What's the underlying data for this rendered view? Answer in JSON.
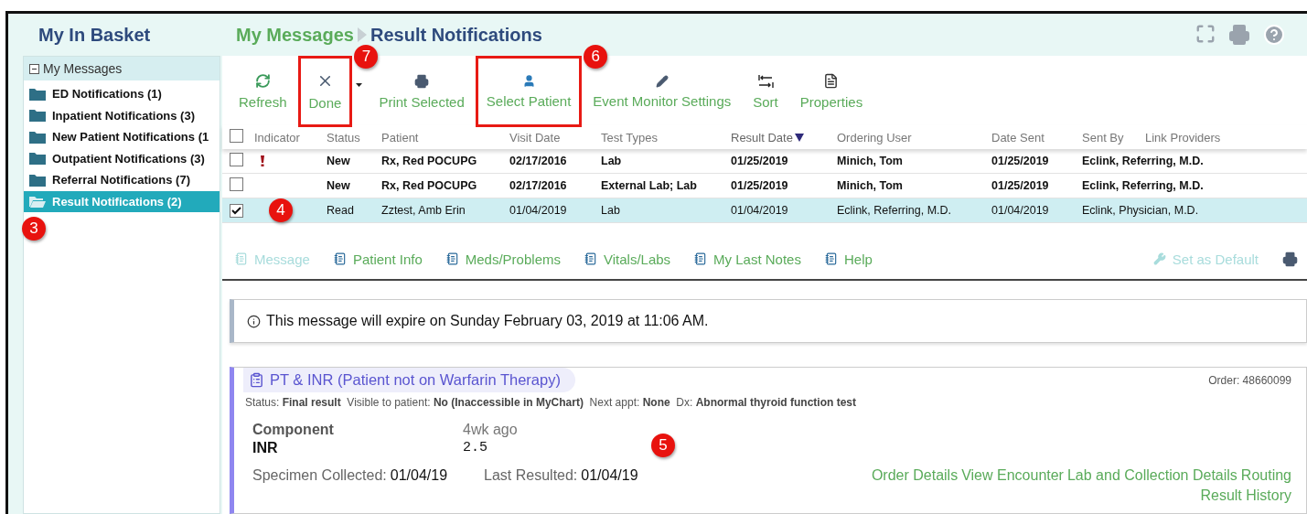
{
  "header": {
    "title": "My In Basket",
    "breadcrumb": [
      {
        "label": "My Messages",
        "current": false
      },
      {
        "label": "Result Notifications",
        "current": true
      }
    ]
  },
  "sidebar": {
    "root": {
      "label": "My Messages",
      "expanded": true
    },
    "folders": [
      {
        "label": "ED Notifications (1)",
        "selected": false
      },
      {
        "label": "Inpatient Notifications (3)",
        "selected": false
      },
      {
        "label": "New Patient Notifications (1",
        "selected": false
      },
      {
        "label": "Outpatient Notifications (3)",
        "selected": false
      },
      {
        "label": "Referral Notifications (7)",
        "selected": false
      },
      {
        "label": "Result Notifications (2)",
        "selected": true,
        "callout": "3"
      }
    ]
  },
  "toolbar": [
    {
      "label": "Refresh",
      "kind": "refresh",
      "highlighted": false
    },
    {
      "label": "Done",
      "kind": "done",
      "highlighted": true,
      "callout": "7",
      "menu": true
    },
    {
      "label": "Print Selected",
      "kind": "print",
      "highlighted": false
    },
    {
      "label": "Select Patient",
      "kind": "patient",
      "highlighted": true,
      "callout": "6"
    },
    {
      "label": "Event Monitor Settings",
      "kind": "settings",
      "highlighted": false
    },
    {
      "label": "Sort",
      "kind": "sort",
      "highlighted": false
    },
    {
      "label": "Properties",
      "kind": "properties",
      "highlighted": false
    }
  ],
  "table": {
    "all_checked": false,
    "columns": [
      {
        "label": "Indicator",
        "sorted": false
      },
      {
        "label": "Status",
        "sorted": false
      },
      {
        "label": "Patient",
        "sorted": false
      },
      {
        "label": "Visit Date",
        "sorted": false
      },
      {
        "label": "Test Types",
        "sorted": false
      },
      {
        "label": "Result Date",
        "sorted": true
      },
      {
        "label": "Ordering User",
        "sorted": false
      },
      {
        "label": "Date Sent",
        "sorted": false
      },
      {
        "label": "Sent By",
        "sorted": false
      },
      {
        "label": "Link Providers",
        "sorted": false
      }
    ],
    "rows": [
      {
        "checked": false,
        "selected": false,
        "unread": true,
        "flagged": true,
        "cells": [
          "",
          "New",
          "Rx, Red POCUPG",
          "02/17/2016",
          "Lab",
          "01/25/2019",
          "Minich, Tom",
          "01/25/2019",
          "Eclink, Referring, M.D."
        ]
      },
      {
        "checked": false,
        "selected": false,
        "unread": true,
        "flagged": false,
        "cells": [
          "",
          "New",
          "Rx, Red POCUPG",
          "02/17/2016",
          "External Lab; Lab",
          "01/25/2019",
          "Minich, Tom",
          "01/25/2019",
          "Eclink, Referring, M.D."
        ]
      },
      {
        "checked": true,
        "selected": true,
        "unread": false,
        "flagged": false,
        "callout": "4",
        "cells": [
          "",
          "Read",
          "Zztest, Amb Erin",
          "01/04/2019",
          "Lab",
          "01/04/2019",
          "Eclink, Referring, M.D.",
          "01/04/2019",
          "Eclink, Physician, M.D."
        ]
      }
    ]
  },
  "nav_links": [
    {
      "label": "Message",
      "disabled": true
    },
    {
      "label": "Patient Info",
      "disabled": false
    },
    {
      "label": "Meds/Problems",
      "disabled": false
    },
    {
      "label": "Vitals/Labs",
      "disabled": false
    },
    {
      "label": "My Last Notes",
      "disabled": false
    },
    {
      "label": "Help",
      "disabled": false
    }
  ],
  "set_default": {
    "label": "Set as Default",
    "disabled": true
  },
  "notice": "This message will expire on Sunday February 03, 2019 at 11:06 AM.",
  "result": {
    "title": "PT & INR (Patient not on Warfarin Therapy)",
    "order": "Order: 48660099",
    "meta": "Status: **Final result**  Visible to patient: **No (Inaccessible in MyChart)**  Next appt: **None**  Dx: **Abnormal thyroid function test**",
    "component_header": "Component",
    "time_header": "4wk ago",
    "component": "INR",
    "value": "2.5",
    "callout": "5",
    "dates": [
      {
        "label": "Specimen Collected:",
        "value": "01/04/19"
      },
      {
        "label": "Last Resulted:",
        "value": "01/04/19"
      }
    ],
    "links": [
      "Order Details",
      "View Encounter",
      "Lab and Collection Details",
      "Routing",
      "Result History"
    ]
  }
}
